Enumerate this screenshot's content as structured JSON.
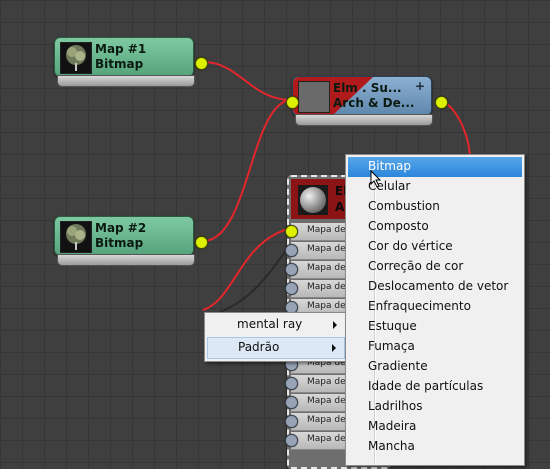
{
  "colors": {
    "wire": "#e2262c",
    "socket": "#ddf000",
    "highlight": "#2c86dc"
  },
  "nodes": {
    "map1": {
      "title": "Map #1",
      "type": "Bitmap",
      "icon": "tree-thumbnail-icon"
    },
    "map2": {
      "title": "Map #2",
      "type": "Bitmap",
      "icon": "tree-thumbnail-icon"
    },
    "composite": {
      "line1": "Elm . Su...",
      "line2": "Arch & De...",
      "icon": "material-thumbnail-icon",
      "expand": "+"
    },
    "material": {
      "line1": "Elm",
      "line2": "Ar",
      "icon": "sphere-preview-icon",
      "slots": [
        "Mapa de",
        "Mapa de",
        "Mapa de",
        "Mapa de",
        "Mapa de",
        "Mapa de",
        "Mapa de",
        "Mapa de",
        "Mapa de",
        "Mapa de",
        "Mapa de",
        "Mapa de"
      ]
    }
  },
  "context_menu": {
    "items": [
      "mental ray",
      "Padrão"
    ]
  },
  "map_menu": {
    "selected": "Bitmap",
    "items": [
      "Bitmap",
      "Celular",
      "Combustion",
      "Composto",
      "Cor do vértice",
      "Correção de cor",
      "Deslocamento de vetor",
      "Enfraquecimento",
      "Estuque",
      "Fumaça",
      "Gradiente",
      "Idade de partículas",
      "Ladrilhos",
      "Madeira",
      "Mancha"
    ]
  }
}
